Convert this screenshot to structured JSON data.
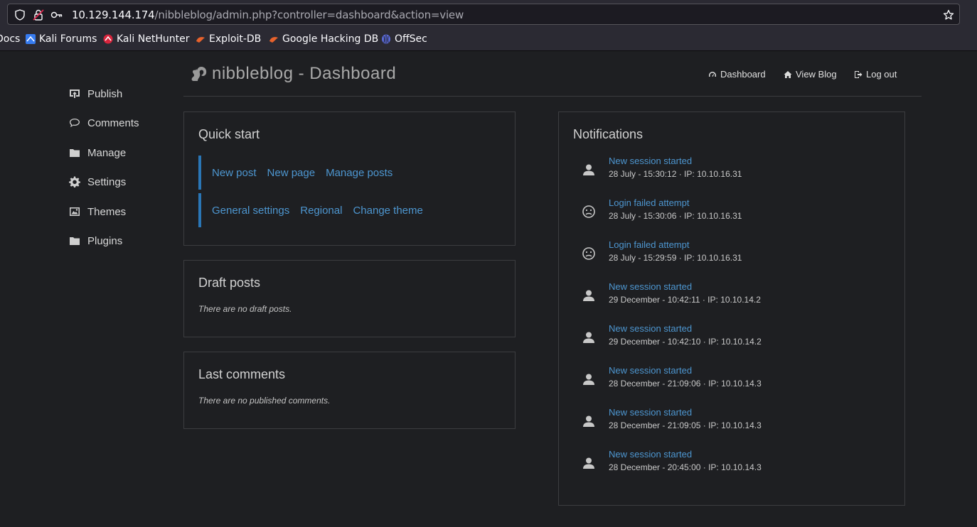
{
  "browser": {
    "url_host": "10.129.144.174",
    "url_path": "/nibbleblog/admin.php?controller=dashboard&action=view",
    "bookmarks": [
      {
        "label": "Docs",
        "icon": "docs-icon"
      },
      {
        "label": "Kali Forums",
        "icon": "kali-forums-icon"
      },
      {
        "label": "Kali NetHunter",
        "icon": "nethunter-icon"
      },
      {
        "label": "Exploit-DB",
        "icon": "exploit-db-icon"
      },
      {
        "label": "Google Hacking DB",
        "icon": "ghdb-icon"
      },
      {
        "label": "OffSec",
        "icon": "offsec-icon"
      }
    ]
  },
  "sidebar": {
    "items": [
      {
        "label": "Publish",
        "icon": "publish-icon"
      },
      {
        "label": "Comments",
        "icon": "comment-icon"
      },
      {
        "label": "Manage",
        "icon": "folder-icon"
      },
      {
        "label": "Settings",
        "icon": "gear-icon"
      },
      {
        "label": "Themes",
        "icon": "image-icon"
      },
      {
        "label": "Plugins",
        "icon": "folder-icon"
      }
    ]
  },
  "header": {
    "title": "nibbleblog - Dashboard",
    "nav": [
      {
        "label": "Dashboard",
        "icon": "dashboard-icon"
      },
      {
        "label": "View Blog",
        "icon": "home-icon"
      },
      {
        "label": "Log out",
        "icon": "logout-icon"
      }
    ]
  },
  "quick_start": {
    "title": "Quick start",
    "row1": [
      "New post",
      "New page",
      "Manage posts"
    ],
    "row2": [
      "General settings",
      "Regional",
      "Change theme"
    ]
  },
  "draft_posts": {
    "title": "Draft posts",
    "empty": "There are no draft posts."
  },
  "last_comments": {
    "title": "Last comments",
    "empty": "There are no published comments."
  },
  "notifications": {
    "title": "Notifications",
    "items": [
      {
        "title": "New session started",
        "detail": "28 July - 15:30:12 · IP: 10.10.16.31",
        "icon": "user-icon"
      },
      {
        "title": "Login failed attempt",
        "detail": "28 July - 15:30:06 · IP: 10.10.16.31",
        "icon": "frown-icon"
      },
      {
        "title": "Login failed attempt",
        "detail": "28 July - 15:29:59 · IP: 10.10.16.31",
        "icon": "frown-icon"
      },
      {
        "title": "New session started",
        "detail": "29 December - 10:42:11 · IP: 10.10.14.2",
        "icon": "user-icon"
      },
      {
        "title": "New session started",
        "detail": "29 December - 10:42:10 · IP: 10.10.14.2",
        "icon": "user-icon"
      },
      {
        "title": "New session started",
        "detail": "28 December - 21:09:06 · IP: 10.10.14.3",
        "icon": "user-icon"
      },
      {
        "title": "New session started",
        "detail": "28 December - 21:09:05 · IP: 10.10.14.3",
        "icon": "user-icon"
      },
      {
        "title": "New session started",
        "detail": "28 December - 20:45:00 · IP: 10.10.14.3",
        "icon": "user-icon"
      }
    ]
  }
}
